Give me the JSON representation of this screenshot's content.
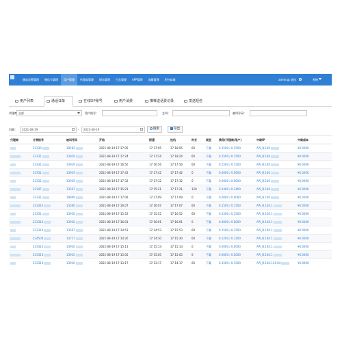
{
  "nav": {
    "menu": [
      "服务告警管理",
      "微信卡管理",
      "用户管理",
      "代理商管理",
      "财务管理",
      "日志管理",
      "APP管理",
      "流量管理",
      "积分商城"
    ],
    "active_index": 2,
    "user": "admingt 退出",
    "system": "系统"
  },
  "tabs": [
    "用户列表",
    "通话详单",
    "在线SIP账号",
    "用户消费",
    "推荐送话费记录",
    "发送短信"
  ],
  "active_tab": 1,
  "filters": {
    "proxy_label": "代理商：",
    "proxy_value": "全部",
    "account_label": "用户账号：",
    "caller_label": "主叫：",
    "called_label": "被叫号码：",
    "date_label": "日期：",
    "date_from": "2021-08-19",
    "date_to": "2021-08-19",
    "search_button": "搜索",
    "export_button": "导出"
  },
  "table": {
    "columns": [
      "代理商",
      "计费账号",
      "被叫号码",
      "开始",
      "接通",
      "挂机",
      "时长",
      "类型",
      "费用(代理商/用户)",
      "中继IP",
      "中继成本"
    ],
    "rows": [
      [
        "23330",
        "18282",
        "2021-08-19 17:17:05",
        "17:17:05",
        "17:18:05",
        "60",
        "下载",
        "0.1500 / 0.1500",
        "API_B.140",
        "¥0.0000"
      ],
      [
        "23331",
        "13919",
        "2021-08-19 17:17:24",
        "17:17:24",
        "17:18:24",
        "60",
        "下载",
        "0.1500 / 0.1500",
        "API_B.140",
        "¥0.0000"
      ],
      [
        "23331",
        "13919",
        "2021-08-19 17:16:56",
        "17:16:56",
        "17:17:56",
        "60",
        "下载",
        "0.1500 / 0.1500",
        "API_B.140",
        "¥0.0000"
      ],
      [
        "23331",
        "13919",
        "2021-08-19 17:17:42",
        "17:17:42",
        "17:17:42",
        "0",
        "下载",
        "0.0000 / 0.0000",
        "API_B.140",
        "¥0.0000"
      ],
      [
        "23331",
        "13919",
        "2021-08-19 17:17:32",
        "17:17:32",
        "17:17:32",
        "0",
        "下载",
        "0.0000 / 0.0000",
        "API_B.140",
        "¥0.0000"
      ],
      [
        "23347",
        "13507",
        "2021-08-19 17:15:21",
        "17:15:21",
        "17:17:21",
        "120",
        "下载",
        "0.2400 / 0.2400",
        "API_B.140",
        "¥0.0000"
      ],
      [
        "23331",
        "18809",
        "2021-08-19 17:17:09",
        "17:17:09",
        "17:17:09",
        "0",
        "下载",
        "0.0000 / 0.0000",
        "API_B.140",
        "¥0.0000"
      ],
      [
        "233310",
        "13560",
        "2021-08-19 17:16:07",
        "17:16:07",
        "17:17:07",
        "60",
        "下载",
        "0.1500 / 0.1500",
        "API_B.140.1",
        "¥0.0000"
      ],
      [
        "23331",
        "13910",
        "2021-08-19 17:15:52",
        "17:15:52",
        "17:16:52",
        "60",
        "下载",
        "0.1500 / 0.1500",
        "API_B.140.1",
        "¥0.0000"
      ],
      [
        "233310",
        "13910",
        "2021-08-19 17:16:01",
        "17:16:01",
        "17:16:01",
        "0",
        "下载",
        "0.0000 / 0.0000",
        "API_B.140.1",
        "¥0.0000"
      ],
      [
        "233310",
        "13567",
        "2021-08-19 17:14:53",
        "17:14:53",
        "17:15:53",
        "60",
        "下载",
        "0.1500 / 0.1500",
        "API_B.140.1",
        "¥0.0000"
      ],
      [
        "234500",
        "13717",
        "2021-08-19 17:14:30",
        "17:14:30",
        "17:15:30",
        "60",
        "下载",
        "0.1200 / 0.1200",
        "API_B.140.1",
        "¥0.0000"
      ],
      [
        "233310",
        "13910",
        "2021-08-19 17:15:13",
        "17:15:13",
        "17:15:13",
        "0",
        "下载",
        "0.0000 / 0.0000",
        "API_B.140.1",
        "¥0.0000"
      ],
      [
        "233310",
        "13910",
        "2021-08-19 17:15:05",
        "17:15:05",
        "17:15:05",
        "0",
        "下载",
        "0.0000 / 0.0000",
        "API_B.140.1",
        "¥0.0000"
      ],
      [
        "233310",
        "13910",
        "2021-08-19 17:13:17",
        "17:13:17",
        "17:14:17",
        "60",
        "下载",
        "0.1500 / 0.1500",
        "API_B.140.141.04",
        "¥0.0000"
      ]
    ]
  }
}
